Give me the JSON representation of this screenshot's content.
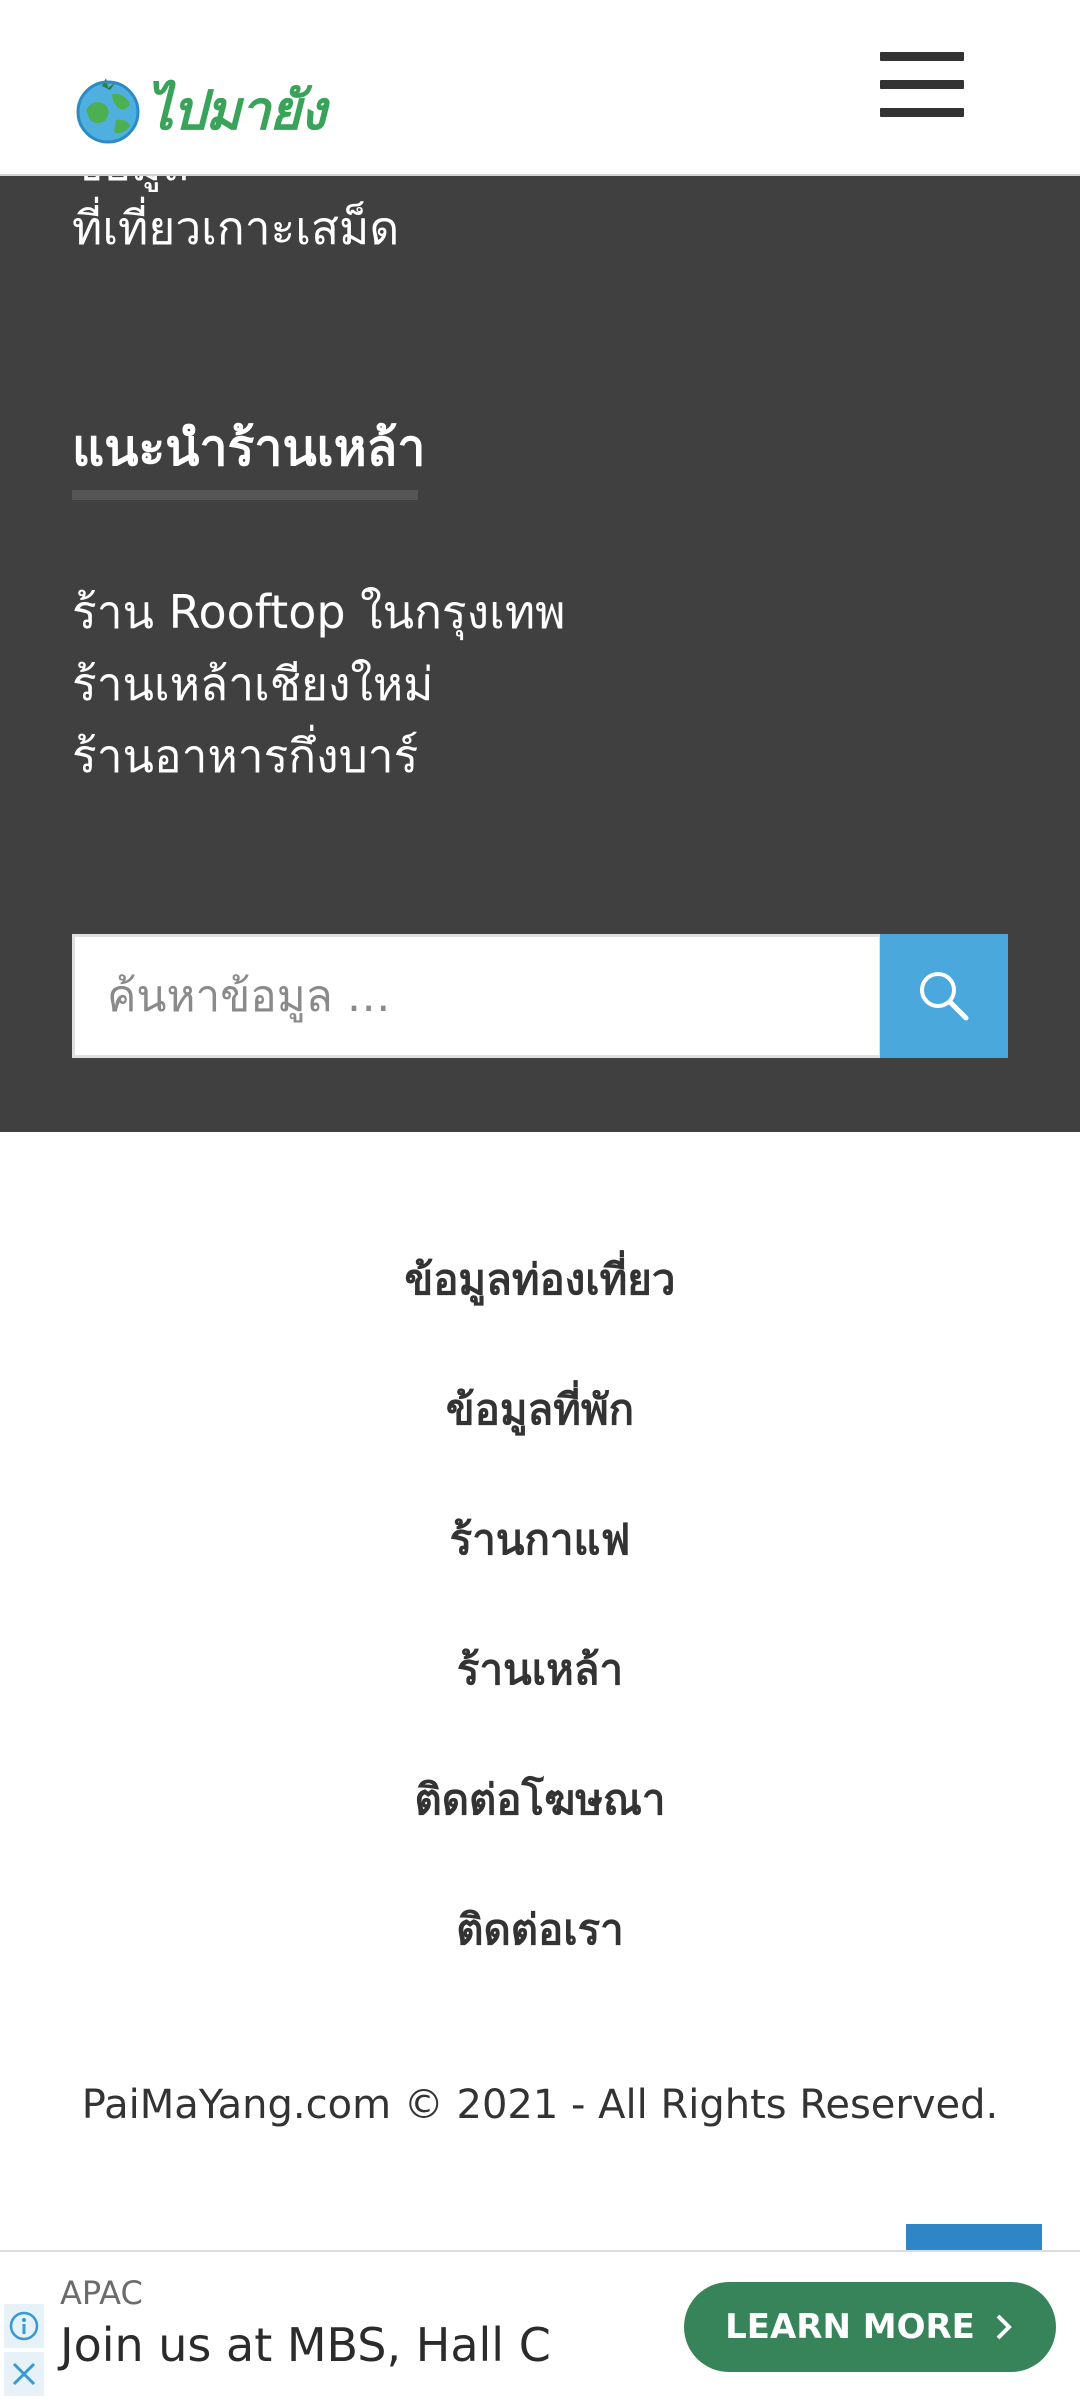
{
  "header": {
    "logo_text": "ไปมายัง"
  },
  "widget": {
    "cut_link": "ข้อมูล",
    "previous_link": "ที่เที่ยวเกาะเสม็ด",
    "title": "แนะนำร้านเหล้า",
    "items": [
      "ร้าน Rooftop ในกรุงเทพ",
      "ร้านเหล้าเชียงใหม่",
      "ร้านอาหารกึ่งบาร์"
    ]
  },
  "search": {
    "placeholder": "ค้นหาข้อมูล …"
  },
  "footer_menu": [
    "ข้อมูลท่องเที่ยว",
    "ข้อมูลที่พัก",
    "ร้านกาแฟ",
    "ร้านเหล้า",
    "ติดต่อโฆษณา",
    "ติดต่อเรา"
  ],
  "copyright": "PaiMaYang.com © 2021 - All Rights Reserved.",
  "ad": {
    "brand": "APAC",
    "headline": "Join us at MBS, Hall C",
    "cta": "LEARN MORE"
  },
  "colors": {
    "dark_bg": "#404040",
    "search_button": "#4aa8dc",
    "logo_green": "#3aa35a",
    "ad_button": "#37845a"
  }
}
